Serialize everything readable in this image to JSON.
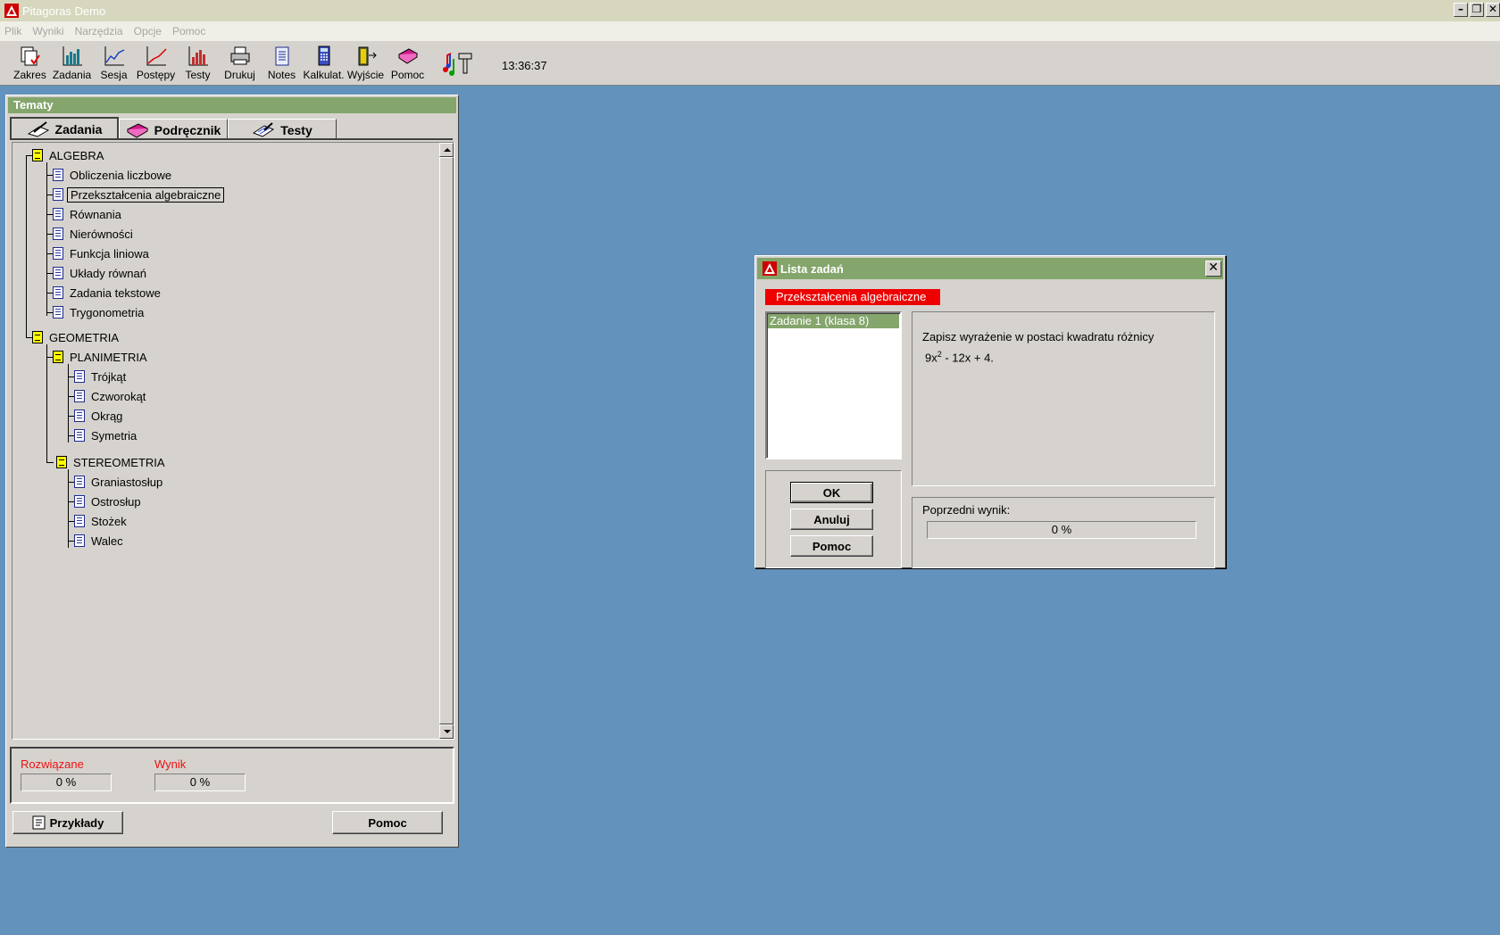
{
  "window": {
    "title": "Pitagoras Demo"
  },
  "menu": [
    "Plik",
    "Wyniki",
    "Narzędzia",
    "Opcje",
    "Pomoc"
  ],
  "toolbar": {
    "items": [
      {
        "label": "Zakres",
        "icon": "scope-icon"
      },
      {
        "label": "Zadania",
        "icon": "bar-chart-icon"
      },
      {
        "label": "Sesja",
        "icon": "line-chart-icon"
      },
      {
        "label": "Postępy",
        "icon": "progress-chart-icon"
      },
      {
        "label": "Testy",
        "icon": "tests-chart-icon"
      },
      {
        "label": "Drukuj",
        "icon": "printer-icon"
      },
      {
        "label": "Notes",
        "icon": "notepad-icon"
      },
      {
        "label": "Kalkulat.",
        "icon": "calculator-icon"
      },
      {
        "label": "Wyjście",
        "icon": "exit-door-icon"
      },
      {
        "label": "Pomoc",
        "icon": "help-book-icon"
      }
    ],
    "clock": "13:36:37"
  },
  "tematy": {
    "title": "Tematy",
    "tabs": [
      "Zadania",
      "Podręcznik",
      "Testy"
    ],
    "tree": [
      {
        "label": "ALGEBRA",
        "type": "folder"
      },
      {
        "label": "Obliczenia liczbowe",
        "type": "page"
      },
      {
        "label": "Przekształcenia algebraiczne",
        "type": "page",
        "selected": true
      },
      {
        "label": "Równania",
        "type": "page"
      },
      {
        "label": "Nierówności",
        "type": "page"
      },
      {
        "label": "Funkcja liniowa",
        "type": "page"
      },
      {
        "label": "Układy równań",
        "type": "page"
      },
      {
        "label": "Zadania tekstowe",
        "type": "page"
      },
      {
        "label": "Trygonometria",
        "type": "page"
      },
      {
        "label": "GEOMETRIA",
        "type": "folder"
      },
      {
        "label": "PLANIMETRIA",
        "type": "folder"
      },
      {
        "label": "Trójkąt",
        "type": "page"
      },
      {
        "label": "Czworokąt",
        "type": "page"
      },
      {
        "label": "Okrąg",
        "type": "page"
      },
      {
        "label": "Symetria",
        "type": "page"
      },
      {
        "label": "STEREOMETRIA",
        "type": "folder"
      },
      {
        "label": "Graniastosłup",
        "type": "page"
      },
      {
        "label": "Ostrosłup",
        "type": "page"
      },
      {
        "label": "Stożek",
        "type": "page"
      },
      {
        "label": "Walec",
        "type": "page"
      }
    ],
    "solved_label": "Rozwiązane",
    "solved_value": "0 %",
    "score_label": "Wynik",
    "score_value": "0 %",
    "examples_button": "Przykłady",
    "help_button": "Pomoc"
  },
  "dialog": {
    "title": "Lista zadań",
    "topic": "Przekształcenia algebraiczne",
    "tasks": [
      "Zadanie 1 (klasa 8)"
    ],
    "description": "Zapisz wyrażenie w postaci kwadratu różnicy",
    "expr_base": "9x",
    "expr_exp": "2",
    "expr_rest": " - 12x + 4.",
    "ok_button": "OK",
    "cancel_button": "Anuluj",
    "help_button": "Pomoc",
    "prev_result_label": "Poprzedni wynik:",
    "prev_result_value": "0 %"
  },
  "colors": {
    "desktop": "#6392bd",
    "title_green": "#84a56b",
    "topic_red": "#ee0000",
    "stat_label_red": "#ee1111"
  }
}
